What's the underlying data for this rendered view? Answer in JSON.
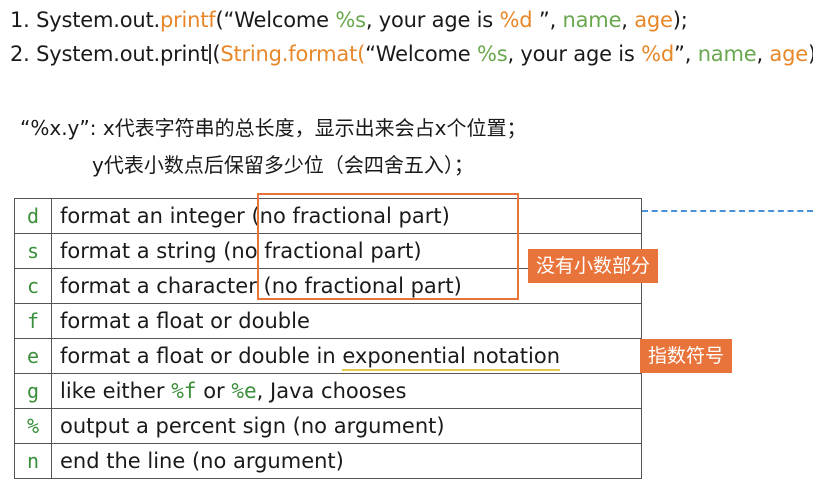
{
  "code_lines": {
    "line1": {
      "prefix": "1. System.out.",
      "method": "printf",
      "open": "(“Welcome ",
      "fmt1": "%s",
      "mid": ", your age is ",
      "fmt2": "%d",
      "after": " ”, ",
      "arg1": "name",
      "comma": ", ",
      "arg2": "age",
      "close": ");"
    },
    "line2": {
      "prefix": "2. System.out.print",
      "paren": "(",
      "method": "String.format(",
      "open": "“Welcome ",
      "fmt1": "%s",
      "mid": ", your age is ",
      "fmt2": "%d",
      "after": "”, ",
      "arg1": "name",
      "comma": ", ",
      "arg2": "age",
      "close": "));"
    }
  },
  "notes": {
    "line1": "“%x.y”: x代表字符串的总长度，显示出来会占x个位置；",
    "line2": "y代表小数点后保留多少位（会四舍五入）；"
  },
  "table": {
    "rows": [
      {
        "code": "d",
        "desc": "format an integer (no fractional part)"
      },
      {
        "code": "s",
        "desc": "format a string (no fractional part)"
      },
      {
        "code": "c",
        "desc": "format a character (no fractional part)"
      },
      {
        "code": "f",
        "desc": "format a float or double"
      },
      {
        "code": "e",
        "desc_pre": "format a float or double in ",
        "desc_ul": "exponential notation"
      },
      {
        "code": "g",
        "desc_a": "like either ",
        "code_f": "%f",
        "desc_b": " or ",
        "code_e": "%e",
        "desc_c": ", Java chooses"
      },
      {
        "code": "%",
        "desc": "output a percent sign (no argument)"
      },
      {
        "code": "n",
        "desc": "end the line (no argument)"
      }
    ]
  },
  "annotations": {
    "no_fraction_tag": "没有小数部分",
    "exponent_tag": "指数符号"
  },
  "colors": {
    "highlight_orange": "#e8872a",
    "box_orange": "#e8743b",
    "code_green": "#3a8f3a",
    "underline_yellow": "#e6c84a",
    "dash_blue": "#4a90d9"
  }
}
